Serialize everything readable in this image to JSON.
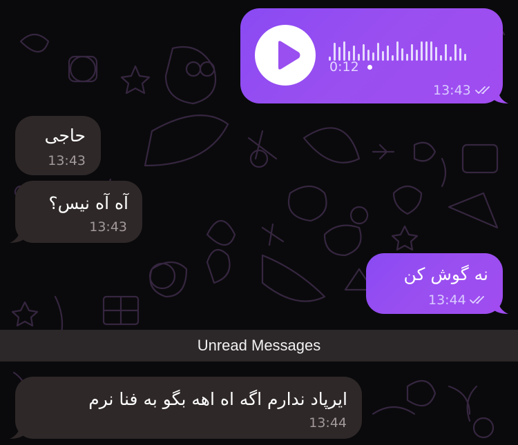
{
  "chat": {
    "messages": [
      {
        "id": "voice",
        "direction": "out",
        "type": "voice",
        "duration": "0:12",
        "time": "13:43",
        "read": true
      },
      {
        "id": "m1",
        "direction": "in",
        "text": "حاجی",
        "time": "13:43"
      },
      {
        "id": "m2",
        "direction": "in",
        "text": "آه آه نیس؟",
        "time": "13:43"
      },
      {
        "id": "m3",
        "direction": "out",
        "text": "نه گوش کن",
        "time": "13:44",
        "read": true
      },
      {
        "id": "m4",
        "direction": "in",
        "text": "ایرپاد ندارم اگه اه اهه بگو به فنا نرم",
        "time": "13:44"
      }
    ],
    "unread_divider": "Unread Messages",
    "colors": {
      "background": "#0a0a0c",
      "incoming_bubble": "#2f2828",
      "outgoing_bubble": "#9a4ff0",
      "pattern_stroke": "#3b2a46"
    },
    "icons": {
      "play": "play-icon",
      "read_receipt": "double-check-icon"
    }
  }
}
